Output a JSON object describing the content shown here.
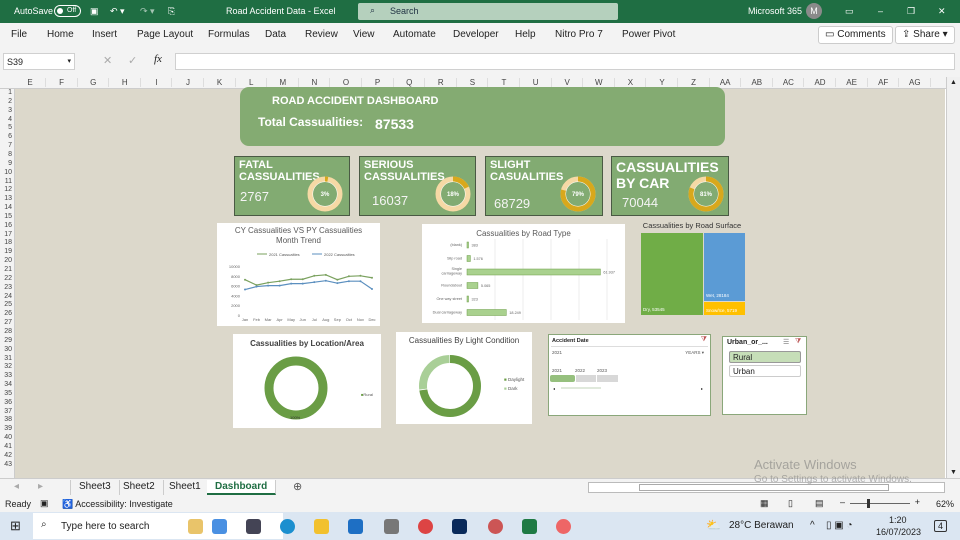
{
  "titlebar": {
    "autosave": "AutoSave",
    "toggle": "Off",
    "doc_title": "Road Accident Data  -  Excel",
    "search": "Search",
    "account": "Microsoft 365",
    "avatar": "M"
  },
  "menu": {
    "items": [
      "File",
      "Home",
      "Insert",
      "Page Layout",
      "Formulas",
      "Data",
      "Review",
      "View",
      "Automate",
      "Developer",
      "Help",
      "Nitro Pro 7",
      "Power Pivot"
    ],
    "comments": "Comments",
    "share": "Share"
  },
  "formula": {
    "namebox": "S39",
    "fx": "fx",
    "value": ""
  },
  "columns": [
    "E",
    "F",
    "G",
    "H",
    "I",
    "J",
    "K",
    "L",
    "M",
    "N",
    "O",
    "P",
    "Q",
    "R",
    "S",
    "T",
    "U",
    "V",
    "W",
    "X",
    "Y",
    "Z",
    "AA",
    "AB",
    "AC",
    "AD",
    "AE",
    "AF",
    "AG"
  ],
  "rows": [
    "1",
    "2",
    "3",
    "4",
    "5",
    "6",
    "7",
    "8",
    "9",
    "10",
    "11",
    "12",
    "13",
    "14",
    "15",
    "16",
    "17",
    "18",
    "19",
    "20",
    "21",
    "22",
    "23",
    "24",
    "25",
    "26",
    "27",
    "28",
    "29",
    "30",
    "31",
    "32",
    "33",
    "34",
    "35",
    "36",
    "37",
    "38",
    "39",
    "40",
    "41",
    "42",
    "43"
  ],
  "dashboard": {
    "title": "ROAD ACCIDENT DASHBOARD",
    "total_label": "Total Cassualities:",
    "total_value": "87533",
    "kpis": [
      {
        "title": "FATAL CASSUALITIES",
        "value": "2767",
        "pct": "3%",
        "fraction": 0.03
      },
      {
        "title": "SERIOUS CASSUALITIES",
        "value": "16037",
        "pct": "18%",
        "fraction": 0.18
      },
      {
        "title": "SLIGHT CASUALITIES",
        "value": "68729",
        "pct": "79%",
        "fraction": 0.79
      },
      {
        "title": "CASSUALITIES BY CAR",
        "value": "70044",
        "pct": "81%",
        "fraction": 0.81
      }
    ]
  },
  "chart_data": [
    {
      "type": "line",
      "title": "CY Cassualities VS PY Cassualities Month Trend",
      "categories": [
        "Jan",
        "Feb",
        "Mar",
        "Apr",
        "May",
        "Jun",
        "Jul",
        "Aug",
        "Sep",
        "Oct",
        "Nov",
        "Dec"
      ],
      "ylim": [
        0,
        10000
      ],
      "yticks": [
        "10000",
        "8000",
        "6000",
        "4000",
        "2000",
        "0"
      ],
      "series": [
        {
          "name": "2021 Cassualties",
          "color": "#7aa15e",
          "values": [
            7200,
            6100,
            6600,
            6900,
            7300,
            7300,
            8000,
            8200,
            7200,
            7900,
            8000,
            7600
          ]
        },
        {
          "name": "2022 Cassualties",
          "color": "#5b8fbf",
          "values": [
            5200,
            5800,
            6000,
            6000,
            6400,
            6400,
            6700,
            7000,
            6500,
            6900,
            6900,
            5300
          ]
        }
      ]
    },
    {
      "type": "bar",
      "title": "Cassualities by Road Type",
      "categories": [
        "(blank)",
        "Slip road",
        "Single carriageway",
        "Roundabout",
        "One way street",
        "Dual carriageway"
      ],
      "values": [
        383,
        1576,
        61937,
        5065,
        323,
        18249
      ],
      "labels": [
        "383",
        "1.576",
        "61.937",
        "5.065",
        "323",
        "18.249"
      ]
    },
    {
      "type": "treemap",
      "title": "Cassualities by Road Surface",
      "items": [
        {
          "label": "Dry, 53545",
          "value": 53545,
          "color": "#70ad47"
        },
        {
          "label": "Wet, 28184",
          "value": 28184,
          "color": "#5b9bd5"
        },
        {
          "label": "Snow/Ice, 5719",
          "value": 5719,
          "color": "#ffc000"
        }
      ]
    },
    {
      "type": "pie",
      "title": "Cassualities by Location/Area",
      "legend": [
        "Rural"
      ],
      "values": [
        1
      ],
      "data_label": "100%"
    },
    {
      "type": "pie",
      "title": "Cassualities By Light Condition",
      "legend": [
        "Daylight",
        "Dark"
      ],
      "values": [
        0.73,
        0.27
      ]
    }
  ],
  "timeline": {
    "title": "Accident Date",
    "selected": "2021",
    "period": "YEARS",
    "years": [
      "2021",
      "2022",
      "2023"
    ]
  },
  "slicer": {
    "title": "Urban_or_...",
    "items": [
      "Rural",
      "Urban"
    ]
  },
  "sheets": [
    "Sheet3",
    "Sheet2",
    "Sheet1",
    "Dashboard"
  ],
  "status": {
    "ready": "Ready",
    "accessibility": "Accessibility: Investigate",
    "zoom": "62%"
  },
  "watermark": {
    "line1": "Activate Windows",
    "line2": "Go to Settings to activate Windows."
  },
  "taskbar": {
    "search": "Type here to search",
    "weather": "28°C  Berawan",
    "time": "1:20",
    "date": "16/07/2023",
    "notif": "4"
  }
}
